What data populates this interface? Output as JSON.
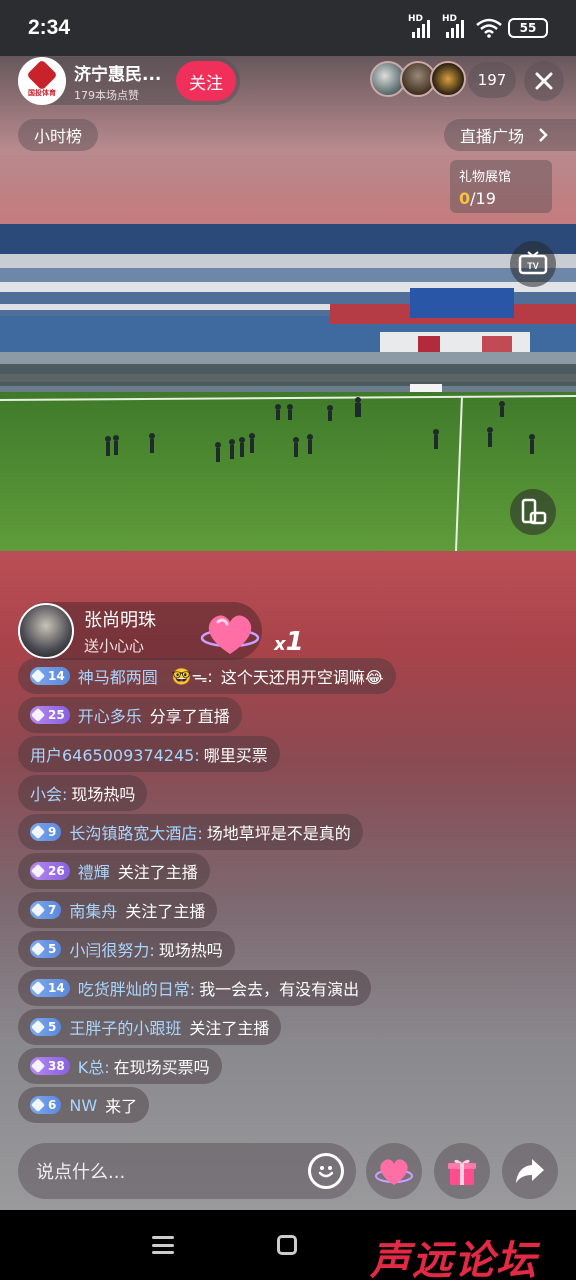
{
  "status": {
    "time": "2:34",
    "net1": "HD",
    "net2": "HD",
    "battery": "55"
  },
  "anchor": {
    "name": "济宁惠民...",
    "likes": "179本场点赞",
    "logo_text": "国投体育",
    "follow_label": "关注"
  },
  "viewers": {
    "count": "197"
  },
  "top": {
    "rank_label": "小时榜",
    "plaza_label": "直播广场"
  },
  "gift_hall": {
    "title": "礼物展馆",
    "collected": "0",
    "total": "/19"
  },
  "gift_banner": {
    "user": "张尚明珠",
    "action": "送小心心",
    "multiplier_x": "x",
    "multiplier_n": "1"
  },
  "chat": [
    {
      "level": "14",
      "tier": "blue",
      "name": "神马都两圆",
      "emoji_prefix": "🤓",
      "sep": "ᯓ:",
      "text": "这个天还用开空调嘛😂"
    },
    {
      "level": "25",
      "tier": "purple",
      "name": "开心多乐",
      "text": "分享了直播"
    },
    {
      "level": "",
      "tier": "",
      "name": "用户6465009374245:",
      "text": "哪里买票"
    },
    {
      "level": "",
      "tier": "",
      "name": "小会:",
      "text": "现场热吗"
    },
    {
      "level": "9",
      "tier": "blue",
      "name": "长沟镇路宽大酒店:",
      "text": "场地草坪是不是真的"
    },
    {
      "level": "26",
      "tier": "purple",
      "name": "禮輝",
      "text": "关注了主播"
    },
    {
      "level": "7",
      "tier": "blue",
      "name": "南集舟",
      "text": "关注了主播"
    },
    {
      "level": "5",
      "tier": "blue",
      "name": "小闫很努力:",
      "text": "现场热吗"
    },
    {
      "level": "14",
      "tier": "blue",
      "name": "吃货胖灿的日常:",
      "text": "我一会去，有没有演出"
    },
    {
      "level": "5",
      "tier": "blue",
      "name": "王胖子的小跟班",
      "text": "关注了主播"
    },
    {
      "level": "38",
      "tier": "purple",
      "name": "K总:",
      "text": "在现场买票吗"
    },
    {
      "level": "6",
      "tier": "blue",
      "name": "NW",
      "text": "来了"
    }
  ],
  "input": {
    "placeholder": "说点什么..."
  },
  "watermark": {
    "text": "声远论坛"
  },
  "colors": {
    "follow": "#f0305a",
    "gift_hall_highlight": "#f5c242",
    "badge_blue": "#6a96e6",
    "badge_purple": "#9a70e8",
    "watermark": "#e22a45"
  },
  "icons": [
    "close-icon",
    "chevron-right-icon",
    "tv-cast-icon",
    "rotate-screen-icon",
    "heart-gift-icon",
    "emoji-icon",
    "like-heart-icon",
    "gift-box-icon",
    "share-arrow-icon"
  ]
}
